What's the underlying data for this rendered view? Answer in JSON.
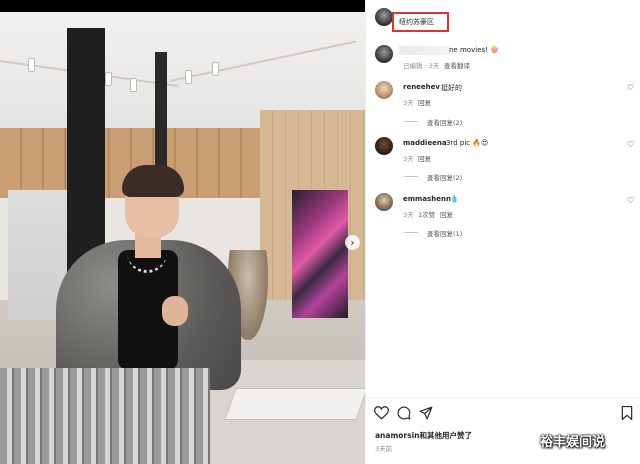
{
  "post": {
    "location": "纽约苏豪区",
    "caption_text": "ne movies! 🍿",
    "caption_meta": "已编辑 · 3天",
    "caption_translate": "查看翻译"
  },
  "comments": [
    {
      "user": "reneehev",
      "text": "挺好的",
      "time": "3天",
      "reply": "回复",
      "view_replies": "查看回复(2)"
    },
    {
      "user": "maddieena",
      "text": "3rd pic 🔥😍",
      "time": "3天",
      "reply": "回复",
      "view_replies": "查看回复(2)"
    },
    {
      "user": "emmashenn",
      "text": "💧",
      "time": "3天",
      "likes": "1次赞",
      "reply": "回复",
      "view_replies": "查看回复(1)"
    }
  ],
  "actions": {
    "like_icon": "heart-icon",
    "comment_icon": "comment-icon",
    "share_icon": "send-icon",
    "save_icon": "bookmark-icon"
  },
  "likes_text": "anamorsin和其他用户赞了",
  "post_time": "3天前",
  "watermark": "裕丰娱间说",
  "nav_arrow": "›",
  "colors": {
    "highlight_box": "#e0322f"
  }
}
